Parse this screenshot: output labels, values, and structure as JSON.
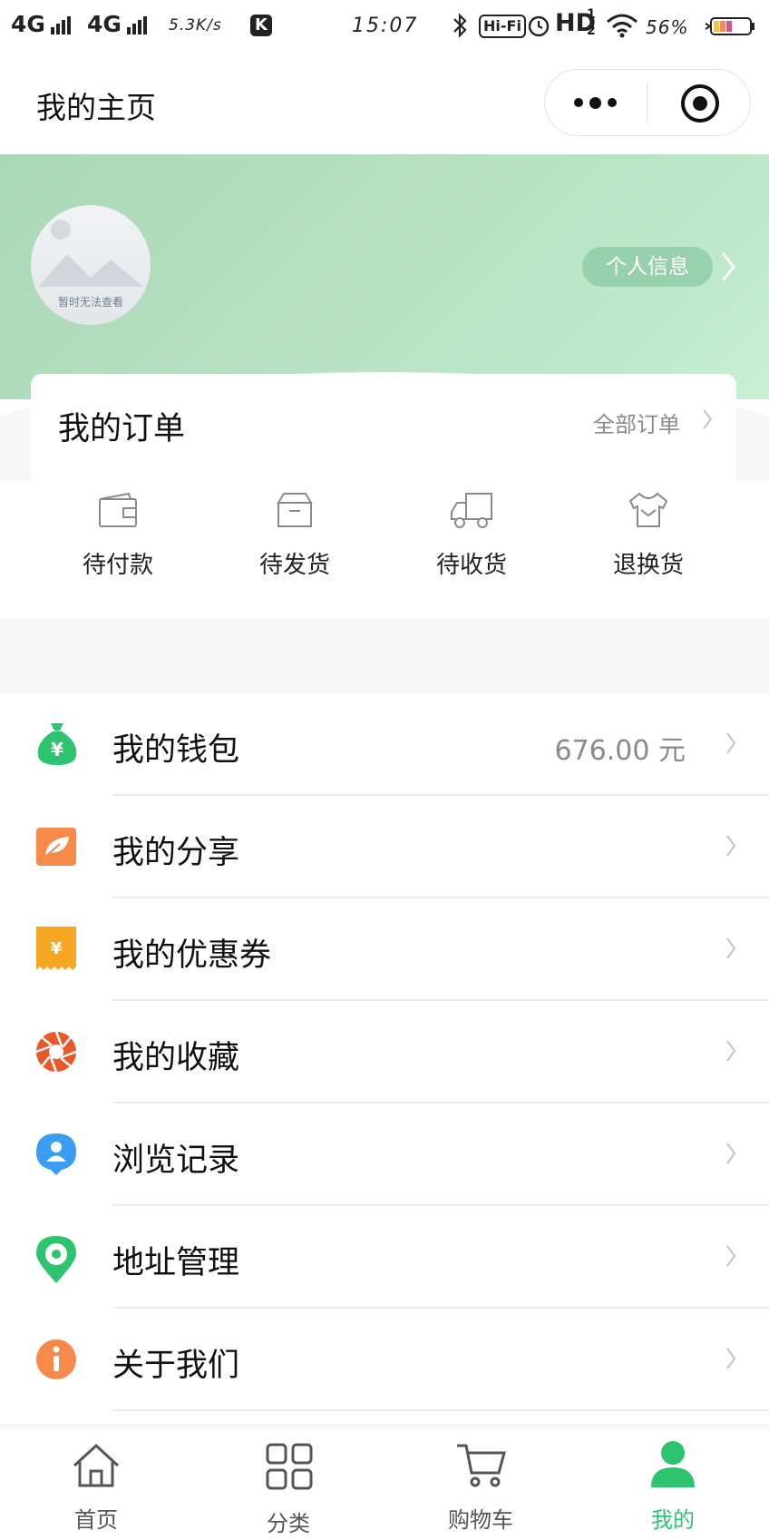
{
  "status_bar": {
    "signal1": "4G",
    "signal2": "4G",
    "speed": "5.3K/s",
    "k_badge": "K",
    "time": "15:07",
    "hifi": "Hi-Fi",
    "hd": "HD",
    "hd_sub": "1",
    "hd_sub2": "2",
    "battery": "56%"
  },
  "nav": {
    "title": "我的主页"
  },
  "profile": {
    "avatar_caption": "暂时无法查看",
    "info_button": "个人信息"
  },
  "orders": {
    "title": "我的订单",
    "all_link": "全部订单",
    "items": [
      {
        "label": "待付款",
        "icon": "wallet-icon"
      },
      {
        "label": "待发货",
        "icon": "box-icon"
      },
      {
        "label": "待收货",
        "icon": "truck-icon"
      },
      {
        "label": "退换货",
        "icon": "return-shirt-icon"
      }
    ]
  },
  "menu": [
    {
      "label": "我的钱包",
      "value": "676.00 元",
      "icon": "money-bag-icon",
      "color": "#2ec46f"
    },
    {
      "label": "我的分享",
      "value": "",
      "icon": "leaf-share-icon",
      "color": "#f58a4b"
    },
    {
      "label": "我的优惠券",
      "value": "",
      "icon": "coupon-icon",
      "color": "#f5a623"
    },
    {
      "label": "我的收藏",
      "value": "",
      "icon": "aperture-icon",
      "color": "#e8582a"
    },
    {
      "label": "浏览记录",
      "value": "",
      "icon": "user-pin-icon",
      "color": "#3a9cf2"
    },
    {
      "label": "地址管理",
      "value": "",
      "icon": "location-pin-icon",
      "color": "#2ec46f"
    },
    {
      "label": "关于我们",
      "value": "",
      "icon": "info-icon",
      "color": "#f58a4b"
    }
  ],
  "tabbar": [
    {
      "label": "首页",
      "icon": "home-icon",
      "active": false
    },
    {
      "label": "分类",
      "icon": "grid-icon",
      "active": false
    },
    {
      "label": "购物车",
      "icon": "cart-icon",
      "active": false
    },
    {
      "label": "我的",
      "icon": "user-icon",
      "active": true
    }
  ],
  "colors": {
    "accent": "#2ec46f",
    "header_green": "#b6e0c1"
  }
}
